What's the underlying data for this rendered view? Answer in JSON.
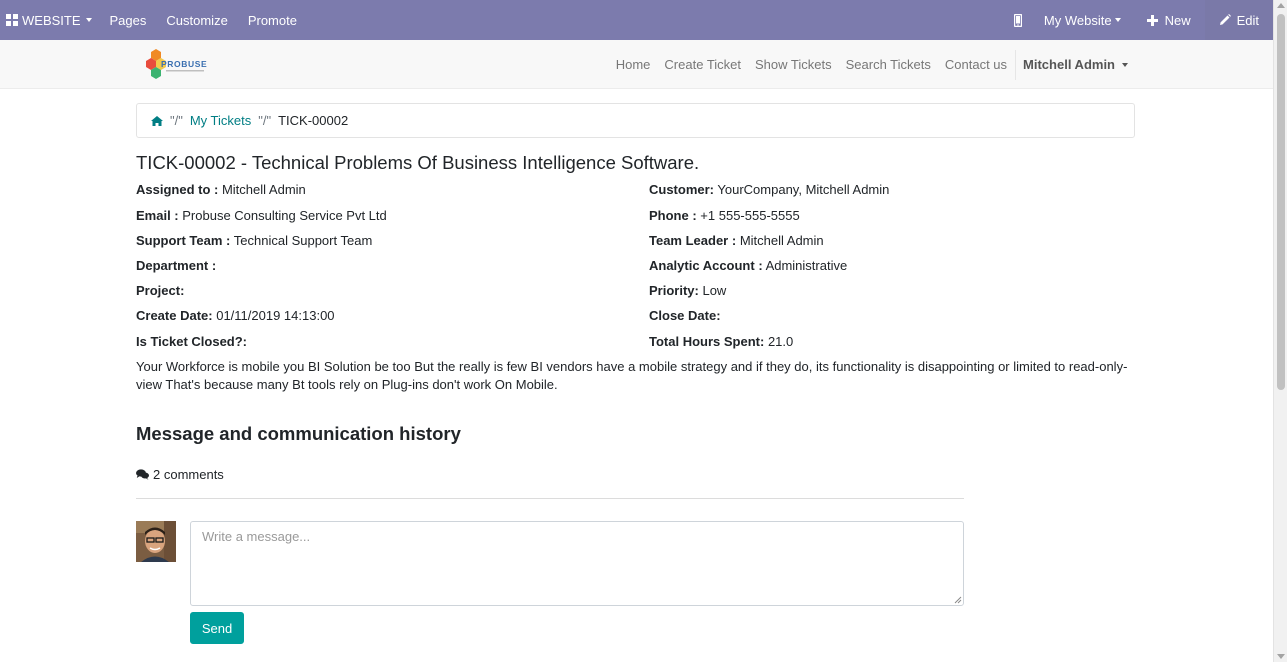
{
  "topbar": {
    "website_label": "WEBSITE",
    "pages_label": "Pages",
    "customize_label": "Customize",
    "promote_label": "Promote",
    "my_website_label": "My Website",
    "new_label": "New",
    "edit_label": "Edit"
  },
  "navbar": {
    "logo_text": "PROBUSE",
    "links": [
      "Home",
      "Create Ticket",
      "Show Tickets",
      "Search Tickets",
      "Contact us"
    ],
    "user_label": "Mitchell Admin"
  },
  "breadcrumb": {
    "sep1": "\"/\"",
    "my_tickets": "My Tickets",
    "sep2": "\"/\"",
    "current": "TICK-00002"
  },
  "ticket": {
    "title": "TICK-00002 - Technical Problems Of Business Intelligence Software.",
    "left_fields": [
      {
        "label": "Assigned to :",
        "value": "Mitchell Admin"
      },
      {
        "label": "Email :",
        "value": "Probuse Consulting Service Pvt Ltd"
      },
      {
        "label": "Support Team :",
        "value": "Technical Support Team"
      },
      {
        "label": "Department :",
        "value": ""
      },
      {
        "label": "Project:",
        "value": ""
      },
      {
        "label": "Create Date:",
        "value": "01/11/2019 14:13:00"
      },
      {
        "label": "Is Ticket Closed?:",
        "value": ""
      }
    ],
    "right_fields": [
      {
        "label": "Customer:",
        "value": "YourCompany, Mitchell Admin"
      },
      {
        "label": "Phone :",
        "value": "+1 555-555-5555"
      },
      {
        "label": "Team Leader :",
        "value": "Mitchell Admin"
      },
      {
        "label": "Analytic Account :",
        "value": "Administrative"
      },
      {
        "label": "Priority:",
        "value": "Low"
      },
      {
        "label": "Close Date:",
        "value": ""
      },
      {
        "label": "Total Hours Spent:",
        "value": "21.0"
      }
    ],
    "description": "Your Workforce is mobile you BI Solution be too But the really is few BI vendors have a mobile strategy and if they do, its functionality is disappointing or limited to read-only-view That's because many Bt tools rely on Plug-ins don't work On Mobile."
  },
  "history": {
    "title": "Message and communication history",
    "comments_count": "2 comments",
    "message_placeholder": "Write a message...",
    "send_label": "Send"
  },
  "colors": {
    "topbar": "#7c7bad",
    "accent": "#00a09d",
    "link": "#017e84"
  },
  "icons": [
    "apps-icon",
    "mobile-icon",
    "plus-icon",
    "pencil-icon",
    "home-icon",
    "comments-icon"
  ]
}
